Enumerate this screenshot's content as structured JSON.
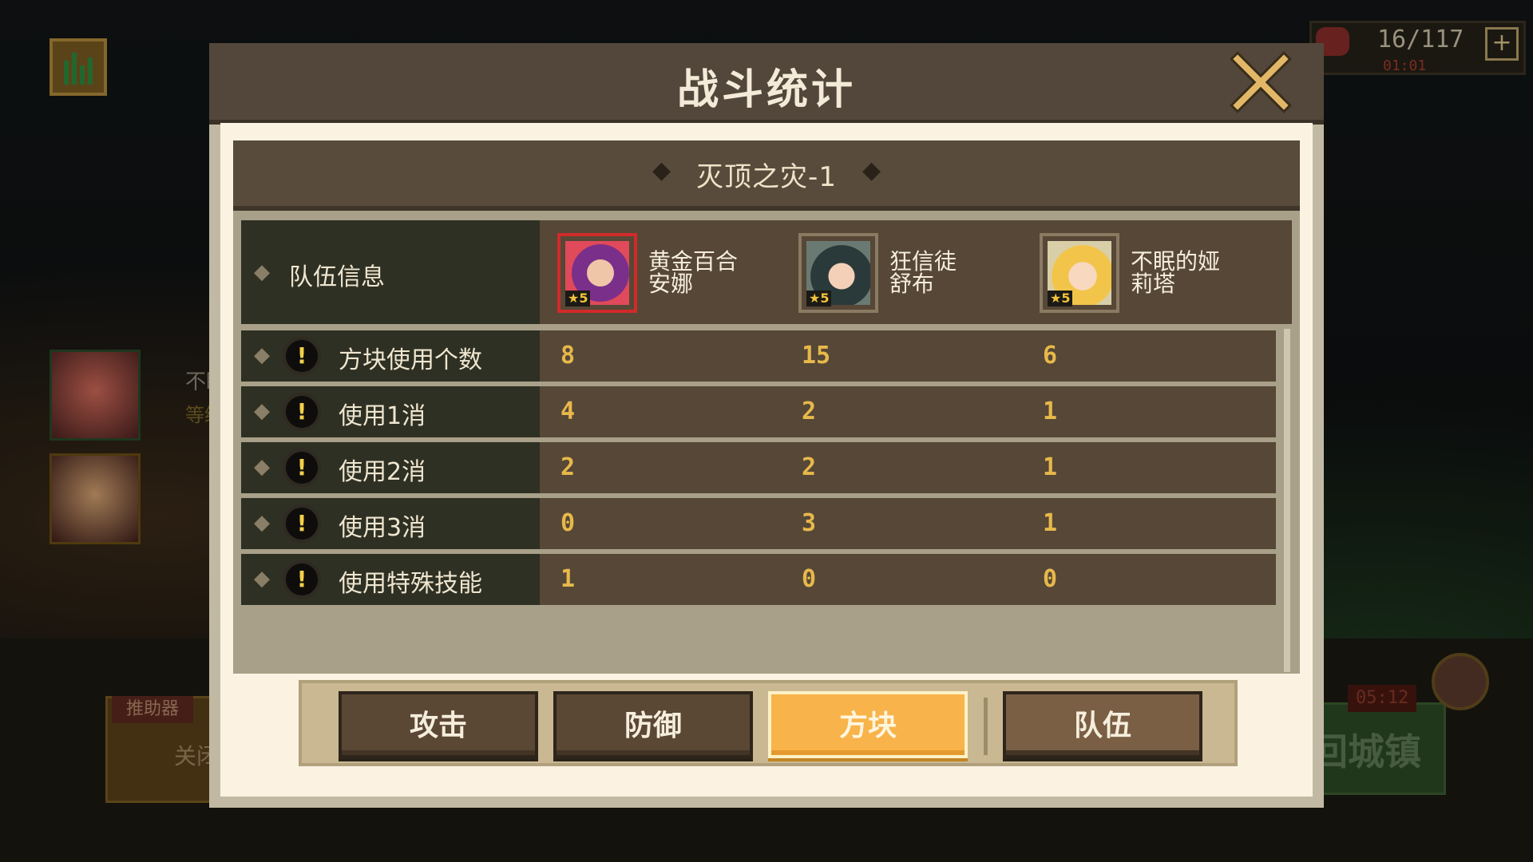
{
  "hud": {
    "resource_count": "16/117",
    "resource_timer": "01:01",
    "plus_label": "+",
    "side_name": "不眠",
    "side_level": "等级",
    "assist_tag": "推助器",
    "assist_state": "关闭",
    "return_town": "回城镇",
    "battle_timer": "05:12"
  },
  "modal": {
    "title": "战斗统计",
    "stage_name": "灭顶之灾-1",
    "prev_arrow": "◆",
    "next_arrow": "◆"
  },
  "table": {
    "header_label": "队伍信息",
    "heroes": [
      {
        "name_line1": "黄金百合",
        "name_line2": "安娜",
        "stars": "5"
      },
      {
        "name_line1": "狂信徒",
        "name_line2": "舒布",
        "stars": "5"
      },
      {
        "name_line1": "不眠的娅",
        "name_line2": "莉塔",
        "stars": "5"
      }
    ],
    "rows": [
      {
        "label": "方块使用个数",
        "values": [
          "8",
          "15",
          "6"
        ]
      },
      {
        "label": "使用1消",
        "values": [
          "4",
          "2",
          "1"
        ]
      },
      {
        "label": "使用2消",
        "values": [
          "2",
          "2",
          "1"
        ]
      },
      {
        "label": "使用3消",
        "values": [
          "0",
          "3",
          "1"
        ]
      },
      {
        "label": "使用特殊技能",
        "values": [
          "1",
          "0",
          "0"
        ]
      }
    ]
  },
  "tabs": [
    {
      "label": "攻击",
      "active": false
    },
    {
      "label": "防御",
      "active": false
    },
    {
      "label": "方块",
      "active": true
    },
    {
      "label": "队伍",
      "active": false
    }
  ],
  "colors": {
    "accent": "#f8b34b",
    "value_text": "#e7b84b",
    "header_bg": "#52473a",
    "selected_border": "#d22a2a"
  },
  "icons": {
    "close": "close-icon",
    "warning": "warning-icon",
    "chevron": "chevron-right-icon"
  }
}
